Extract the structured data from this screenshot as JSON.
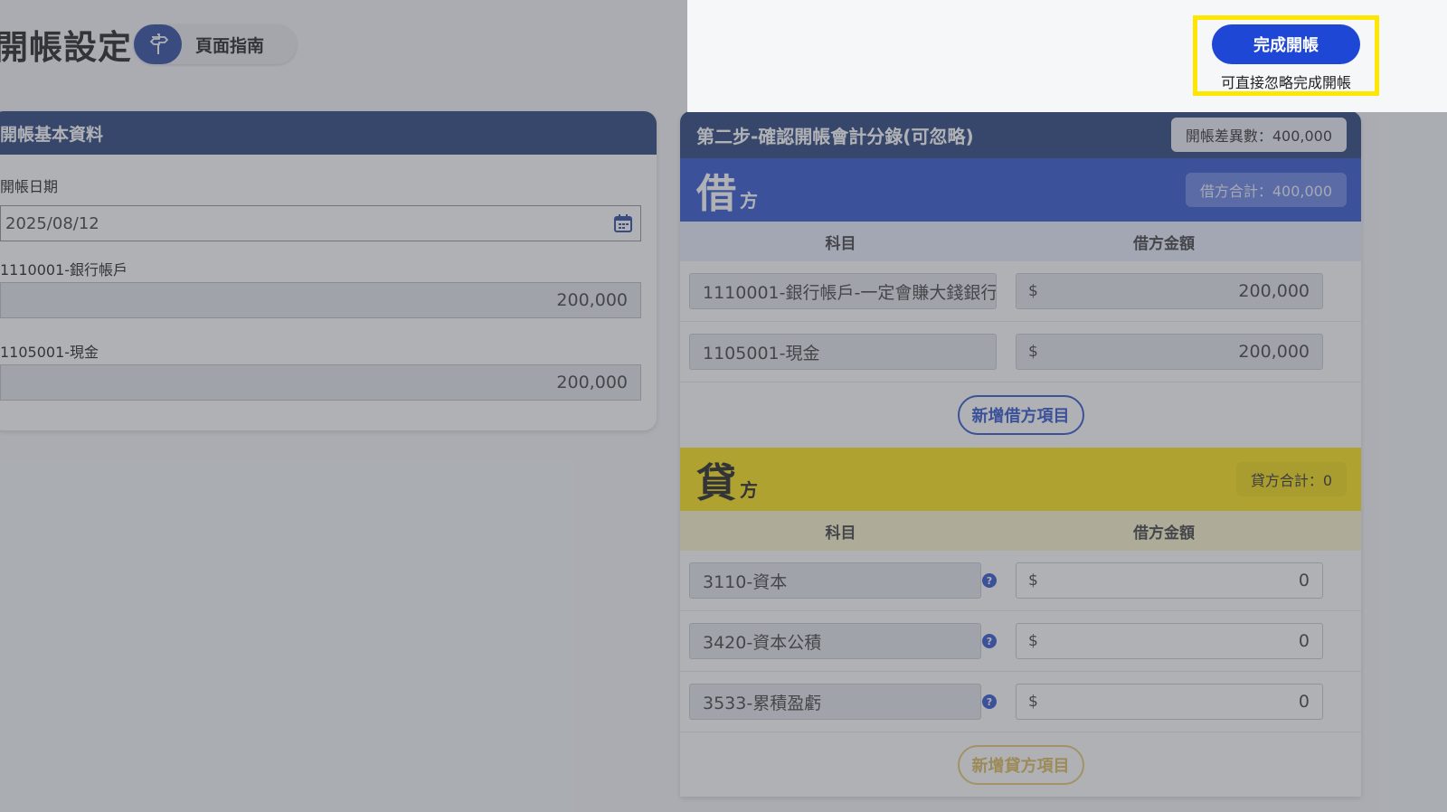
{
  "page": {
    "title": "開帳設定",
    "guide_label": "頁面指南",
    "guide_icon": "signpost-icon"
  },
  "basic": {
    "header": "開帳基本資料",
    "date_label": "開帳日期",
    "date_value": "2025/08/12",
    "fields": [
      {
        "label": "1110001-銀行帳戶",
        "value": "200,000"
      },
      {
        "label": "1105001-現金",
        "value": "200,000"
      }
    ]
  },
  "entries": {
    "title": "第二步-確認開帳會計分錄(可忽略)",
    "difference": "開帳差異數：400,000",
    "debit": {
      "big": "借",
      "small": "方",
      "total": "借方合計：400,000",
      "col_account": "科目",
      "col_amount": "借方金額",
      "rows": [
        {
          "account": "1110001-銀行帳戶-一定會賺大錢銀行",
          "currency": "$",
          "amount": "200,000"
        },
        {
          "account": "1105001-現金",
          "currency": "$",
          "amount": "200,000"
        }
      ],
      "add_label": "新增借方項目"
    },
    "credit": {
      "big": "貸",
      "small": "方",
      "total": "貸方合計：0",
      "col_account": "科目",
      "col_amount": "借方金額",
      "rows": [
        {
          "account": "3110-資本",
          "currency": "$",
          "amount": "0"
        },
        {
          "account": "3420-資本公積",
          "currency": "$",
          "amount": "0"
        },
        {
          "account": "3533-累積盈虧",
          "currency": "$",
          "amount": "0"
        }
      ],
      "add_label": "新增貸方項目"
    }
  },
  "tour": {
    "finish_label": "完成開帳",
    "hint": "可直接忽略完成開帳",
    "highlight_color": "#ffe600"
  },
  "colors": {
    "navy": "#173372",
    "debit_blue": "#1f47c9",
    "credit_yellow": "#fde300"
  }
}
